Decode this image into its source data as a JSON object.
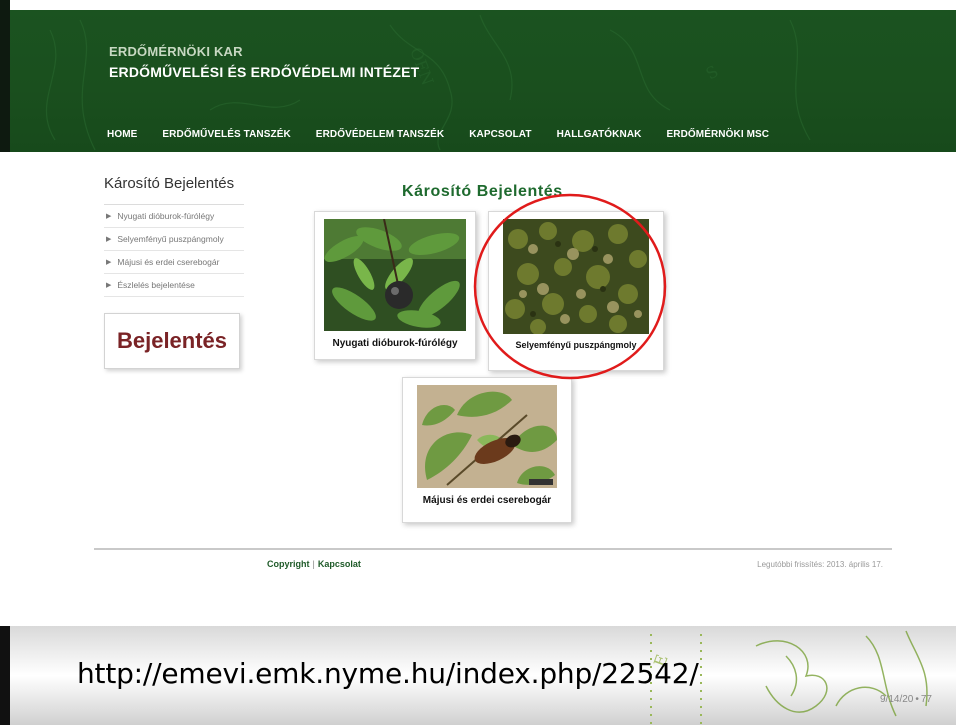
{
  "header": {
    "faculty": "ERDŐMÉRNÖKI KAR",
    "institute": "ERDŐMŰVELÉSI ÉS ERDŐVÉDELMI INTÉZET",
    "nav": [
      {
        "label": "HOME"
      },
      {
        "label": "ERDŐMŰVELÉS TANSZÉK"
      },
      {
        "label": "ERDŐVÉDELEM TANSZÉK"
      },
      {
        "label": "KAPCSOLAT"
      },
      {
        "label": "HALLGATÓKNAK"
      },
      {
        "label": "ERDŐMÉRNÖKI MSC"
      }
    ]
  },
  "sidebar": {
    "title": "Károsító Bejelentés",
    "items": [
      {
        "label": "Nyugati dióburok-fúrólégy"
      },
      {
        "label": "Selyemfényű puszpángmoly"
      },
      {
        "label": "Májusi és erdei cserebogár"
      },
      {
        "label": "Észlelés bejelentése"
      }
    ],
    "report_button": "Bejelentés"
  },
  "main": {
    "title": "Károsító Bejelentés",
    "cards": [
      {
        "label": "Nyugati dióburok-fúrólégy",
        "icon": "walnut-husk-fly-photo"
      },
      {
        "label": "Selyemfényű puszpángmoly",
        "icon": "box-tree-moth-photo",
        "highlight": "#e01b1b"
      },
      {
        "label": "Májusi és erdei cserebogár",
        "icon": "cockchafer-photo"
      }
    ]
  },
  "footer": {
    "copyright": "Copyright",
    "contact": "Kapcsolat",
    "separator": "|",
    "updated": "Legutóbbi frissítés: 2013. április 17."
  },
  "slide": {
    "url": "http://emevi.emk.nyme.hu/index.php/22542/",
    "date": "9/14/20",
    "page_number": "77"
  },
  "colors": {
    "header_green": "#1a4f1e",
    "title_green": "#1e6a2e",
    "report_red": "#7a2326",
    "highlight_red": "#e01b1b"
  }
}
